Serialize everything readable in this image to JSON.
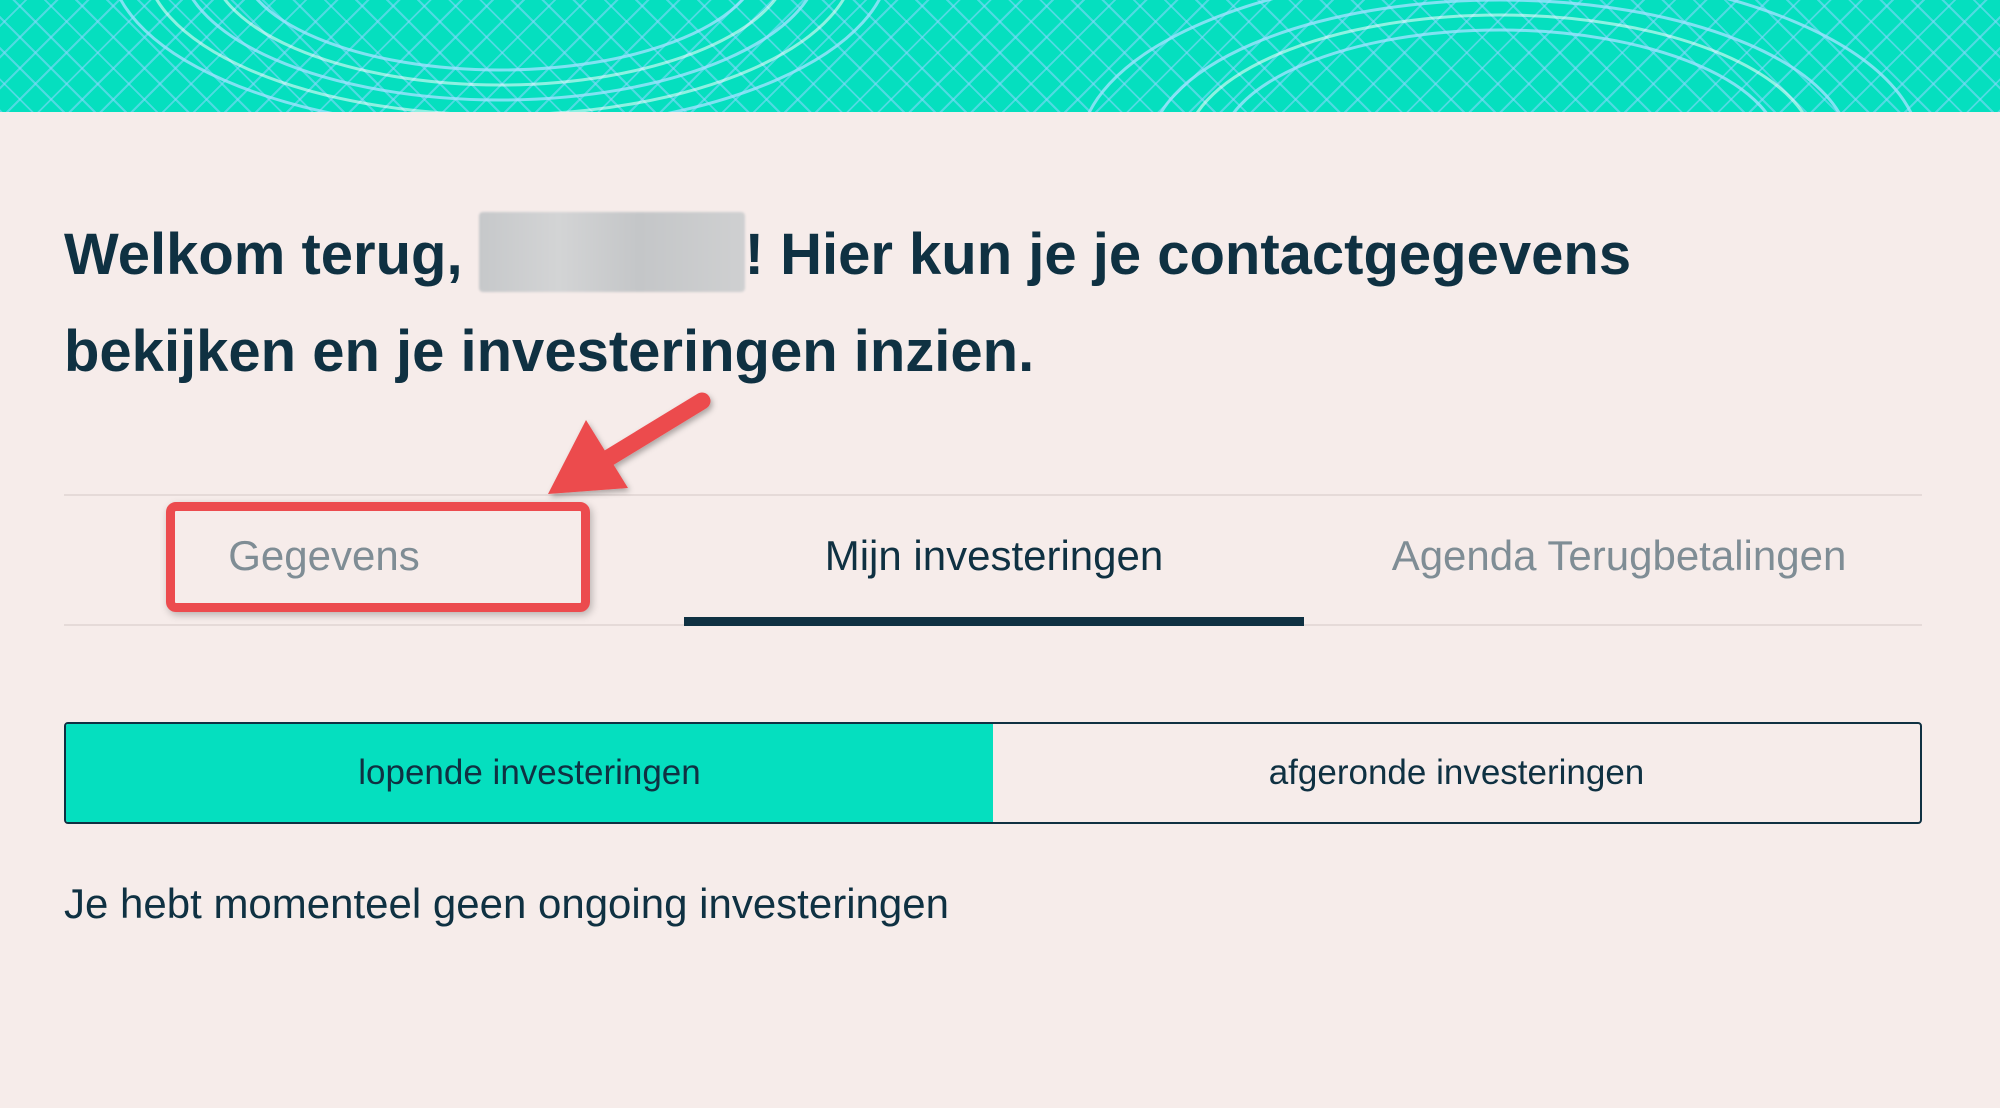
{
  "header": {
    "banner_color": "#05dfbf"
  },
  "welcome": {
    "greeting": "Welkom terug, ",
    "message": "! Hier kun je je contactgegevens bekijken en je investeringen inzien."
  },
  "tabs": [
    {
      "label": "Gegevens",
      "active": false
    },
    {
      "label": "Mijn investeringen",
      "active": true
    },
    {
      "label": "Agenda Terugbetalingen",
      "active": false
    }
  ],
  "segments": [
    {
      "label": "lopende investeringen",
      "active": true
    },
    {
      "label": "afgeronde investeringen",
      "active": false
    }
  ],
  "empty_state": {
    "message": "Je hebt momenteel geen ongoing investeringen"
  },
  "colors": {
    "accent": "#05dfbf",
    "text_primary": "#0f3142",
    "text_muted": "#7f8d95",
    "background": "#f6ecea",
    "annotation": "#ec4b4e"
  }
}
